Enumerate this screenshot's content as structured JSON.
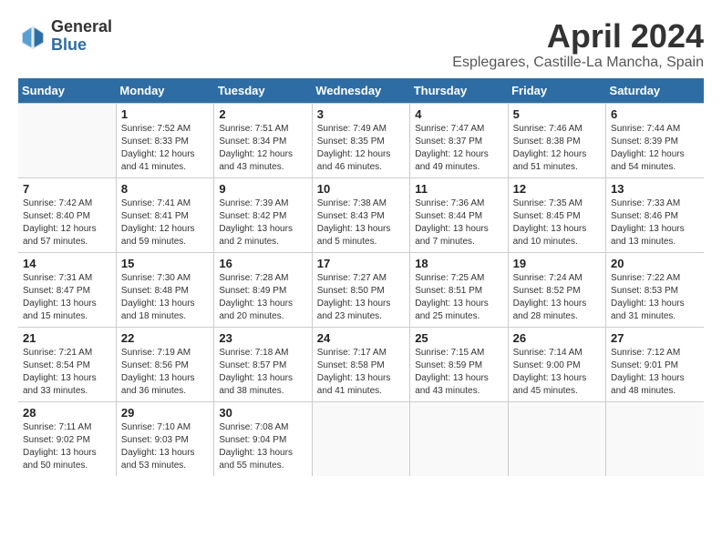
{
  "logo": {
    "general": "General",
    "blue": "Blue"
  },
  "title": "April 2024",
  "location": "Esplegares, Castille-La Mancha, Spain",
  "weekdays": [
    "Sunday",
    "Monday",
    "Tuesday",
    "Wednesday",
    "Thursday",
    "Friday",
    "Saturday"
  ],
  "weeks": [
    [
      {
        "day": "",
        "sunrise": "",
        "sunset": "",
        "daylight": ""
      },
      {
        "day": "1",
        "sunrise": "Sunrise: 7:52 AM",
        "sunset": "Sunset: 8:33 PM",
        "daylight": "Daylight: 12 hours and 41 minutes."
      },
      {
        "day": "2",
        "sunrise": "Sunrise: 7:51 AM",
        "sunset": "Sunset: 8:34 PM",
        "daylight": "Daylight: 12 hours and 43 minutes."
      },
      {
        "day": "3",
        "sunrise": "Sunrise: 7:49 AM",
        "sunset": "Sunset: 8:35 PM",
        "daylight": "Daylight: 12 hours and 46 minutes."
      },
      {
        "day": "4",
        "sunrise": "Sunrise: 7:47 AM",
        "sunset": "Sunset: 8:37 PM",
        "daylight": "Daylight: 12 hours and 49 minutes."
      },
      {
        "day": "5",
        "sunrise": "Sunrise: 7:46 AM",
        "sunset": "Sunset: 8:38 PM",
        "daylight": "Daylight: 12 hours and 51 minutes."
      },
      {
        "day": "6",
        "sunrise": "Sunrise: 7:44 AM",
        "sunset": "Sunset: 8:39 PM",
        "daylight": "Daylight: 12 hours and 54 minutes."
      }
    ],
    [
      {
        "day": "7",
        "sunrise": "Sunrise: 7:42 AM",
        "sunset": "Sunset: 8:40 PM",
        "daylight": "Daylight: 12 hours and 57 minutes."
      },
      {
        "day": "8",
        "sunrise": "Sunrise: 7:41 AM",
        "sunset": "Sunset: 8:41 PM",
        "daylight": "Daylight: 12 hours and 59 minutes."
      },
      {
        "day": "9",
        "sunrise": "Sunrise: 7:39 AM",
        "sunset": "Sunset: 8:42 PM",
        "daylight": "Daylight: 13 hours and 2 minutes."
      },
      {
        "day": "10",
        "sunrise": "Sunrise: 7:38 AM",
        "sunset": "Sunset: 8:43 PM",
        "daylight": "Daylight: 13 hours and 5 minutes."
      },
      {
        "day": "11",
        "sunrise": "Sunrise: 7:36 AM",
        "sunset": "Sunset: 8:44 PM",
        "daylight": "Daylight: 13 hours and 7 minutes."
      },
      {
        "day": "12",
        "sunrise": "Sunrise: 7:35 AM",
        "sunset": "Sunset: 8:45 PM",
        "daylight": "Daylight: 13 hours and 10 minutes."
      },
      {
        "day": "13",
        "sunrise": "Sunrise: 7:33 AM",
        "sunset": "Sunset: 8:46 PM",
        "daylight": "Daylight: 13 hours and 13 minutes."
      }
    ],
    [
      {
        "day": "14",
        "sunrise": "Sunrise: 7:31 AM",
        "sunset": "Sunset: 8:47 PM",
        "daylight": "Daylight: 13 hours and 15 minutes."
      },
      {
        "day": "15",
        "sunrise": "Sunrise: 7:30 AM",
        "sunset": "Sunset: 8:48 PM",
        "daylight": "Daylight: 13 hours and 18 minutes."
      },
      {
        "day": "16",
        "sunrise": "Sunrise: 7:28 AM",
        "sunset": "Sunset: 8:49 PM",
        "daylight": "Daylight: 13 hours and 20 minutes."
      },
      {
        "day": "17",
        "sunrise": "Sunrise: 7:27 AM",
        "sunset": "Sunset: 8:50 PM",
        "daylight": "Daylight: 13 hours and 23 minutes."
      },
      {
        "day": "18",
        "sunrise": "Sunrise: 7:25 AM",
        "sunset": "Sunset: 8:51 PM",
        "daylight": "Daylight: 13 hours and 25 minutes."
      },
      {
        "day": "19",
        "sunrise": "Sunrise: 7:24 AM",
        "sunset": "Sunset: 8:52 PM",
        "daylight": "Daylight: 13 hours and 28 minutes."
      },
      {
        "day": "20",
        "sunrise": "Sunrise: 7:22 AM",
        "sunset": "Sunset: 8:53 PM",
        "daylight": "Daylight: 13 hours and 31 minutes."
      }
    ],
    [
      {
        "day": "21",
        "sunrise": "Sunrise: 7:21 AM",
        "sunset": "Sunset: 8:54 PM",
        "daylight": "Daylight: 13 hours and 33 minutes."
      },
      {
        "day": "22",
        "sunrise": "Sunrise: 7:19 AM",
        "sunset": "Sunset: 8:56 PM",
        "daylight": "Daylight: 13 hours and 36 minutes."
      },
      {
        "day": "23",
        "sunrise": "Sunrise: 7:18 AM",
        "sunset": "Sunset: 8:57 PM",
        "daylight": "Daylight: 13 hours and 38 minutes."
      },
      {
        "day": "24",
        "sunrise": "Sunrise: 7:17 AM",
        "sunset": "Sunset: 8:58 PM",
        "daylight": "Daylight: 13 hours and 41 minutes."
      },
      {
        "day": "25",
        "sunrise": "Sunrise: 7:15 AM",
        "sunset": "Sunset: 8:59 PM",
        "daylight": "Daylight: 13 hours and 43 minutes."
      },
      {
        "day": "26",
        "sunrise": "Sunrise: 7:14 AM",
        "sunset": "Sunset: 9:00 PM",
        "daylight": "Daylight: 13 hours and 45 minutes."
      },
      {
        "day": "27",
        "sunrise": "Sunrise: 7:12 AM",
        "sunset": "Sunset: 9:01 PM",
        "daylight": "Daylight: 13 hours and 48 minutes."
      }
    ],
    [
      {
        "day": "28",
        "sunrise": "Sunrise: 7:11 AM",
        "sunset": "Sunset: 9:02 PM",
        "daylight": "Daylight: 13 hours and 50 minutes."
      },
      {
        "day": "29",
        "sunrise": "Sunrise: 7:10 AM",
        "sunset": "Sunset: 9:03 PM",
        "daylight": "Daylight: 13 hours and 53 minutes."
      },
      {
        "day": "30",
        "sunrise": "Sunrise: 7:08 AM",
        "sunset": "Sunset: 9:04 PM",
        "daylight": "Daylight: 13 hours and 55 minutes."
      },
      {
        "day": "",
        "sunrise": "",
        "sunset": "",
        "daylight": ""
      },
      {
        "day": "",
        "sunrise": "",
        "sunset": "",
        "daylight": ""
      },
      {
        "day": "",
        "sunrise": "",
        "sunset": "",
        "daylight": ""
      },
      {
        "day": "",
        "sunrise": "",
        "sunset": "",
        "daylight": ""
      }
    ]
  ]
}
